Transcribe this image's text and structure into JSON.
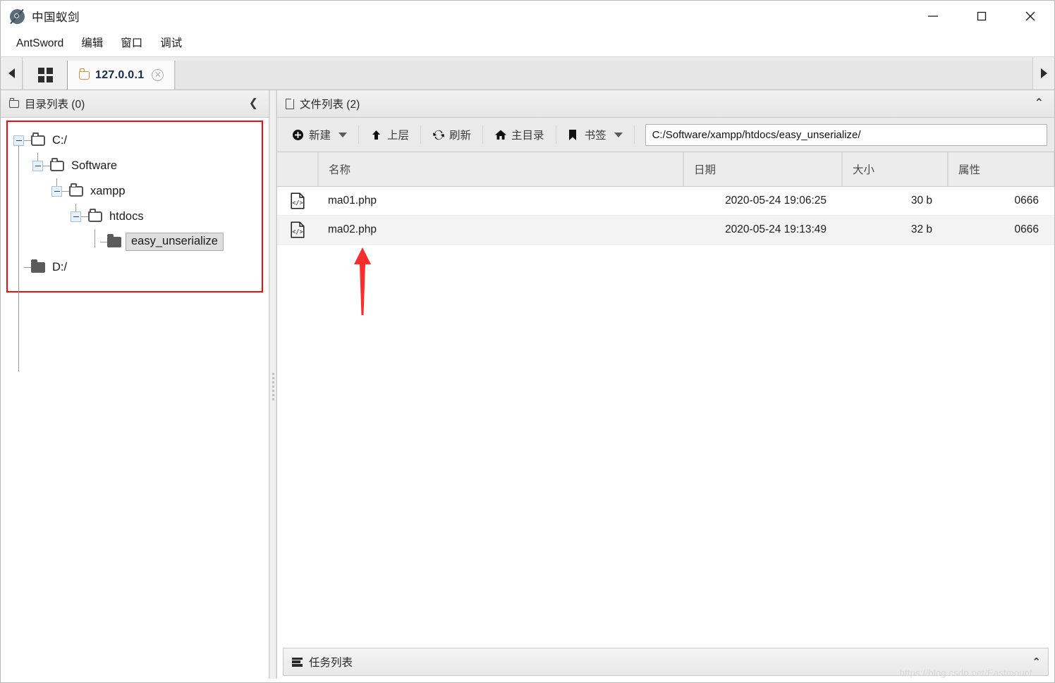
{
  "window": {
    "title": "中国蚁剑",
    "logo_icon": "antsword-logo-icon",
    "minimize_label": "—",
    "maximize_label": "□",
    "close_label": "✕"
  },
  "menubar": {
    "items": [
      {
        "label": "AntSword"
      },
      {
        "label": "编辑"
      },
      {
        "label": "窗口"
      },
      {
        "label": "调试"
      }
    ]
  },
  "tabbar": {
    "scroll_left_icon": "chevron-left-icon",
    "scroll_right_icon": "chevron-right-icon",
    "grid_button_icon": "grid-icon",
    "tabs": [
      {
        "label": "127.0.0.1",
        "icon": "folder-icon",
        "close_icon": "close-circle-icon",
        "active": true
      }
    ]
  },
  "directory_panel": {
    "icon": "folder-icon",
    "title": "目录列表 (0)",
    "collapse_icon": "chevron-left-icon",
    "tree": [
      {
        "label": "C:/",
        "depth": 0,
        "toggle": "minus",
        "folder": "open",
        "selected": false
      },
      {
        "label": "Software",
        "depth": 1,
        "toggle": "minus",
        "folder": "open",
        "selected": false
      },
      {
        "label": "xampp",
        "depth": 2,
        "toggle": "minus",
        "folder": "open",
        "selected": false
      },
      {
        "label": "htdocs",
        "depth": 3,
        "toggle": "minus",
        "folder": "open",
        "selected": false
      },
      {
        "label": "easy_unserialize",
        "depth": 4,
        "toggle": "none",
        "folder": "closed",
        "selected": true
      },
      {
        "label": "D:/",
        "depth": 0,
        "toggle": "none",
        "folder": "closed",
        "selected": false
      }
    ],
    "highlight_color": "#f10c0c"
  },
  "file_panel": {
    "icon": "file-icon",
    "title": "文件列表 (2)",
    "collapse_icon": "chevron-up-icon",
    "toolbar": [
      {
        "label": "新建",
        "icon": "plus-circle-icon",
        "dropdown": true
      },
      {
        "label": "上层",
        "icon": "arrow-up-icon",
        "dropdown": false
      },
      {
        "label": "刷新",
        "icon": "refresh-icon",
        "dropdown": false
      },
      {
        "label": "主目录",
        "icon": "home-icon",
        "dropdown": false
      },
      {
        "label": "书签",
        "icon": "bookmark-icon",
        "dropdown": true
      }
    ],
    "path": {
      "value": "C:/Software/xampp/htdocs/easy_unserialize/",
      "placeholder": "C:/"
    },
    "columns": [
      {
        "key": "icon",
        "label": ""
      },
      {
        "key": "name",
        "label": "名称"
      },
      {
        "key": "date",
        "label": "日期"
      },
      {
        "key": "size",
        "label": "大小"
      },
      {
        "key": "attr",
        "label": "属性"
      }
    ],
    "rows": [
      {
        "icon": "php-file-icon",
        "name": "ma01.php",
        "date": "2020-05-24 19:06:25",
        "size": "30 b",
        "attr": "0666"
      },
      {
        "icon": "php-file-icon",
        "name": "ma02.php",
        "date": "2020-05-24 19:13:49",
        "size": "32 b",
        "attr": "0666"
      }
    ]
  },
  "annotation": {
    "arrow_color": "#fa2d2d",
    "arrow_icon": "arrow-up-annotation-icon"
  },
  "footer": {
    "icon": "task-list-icon",
    "title": "任务列表",
    "collapse_icon": "chevron-up-icon",
    "watermark": "https://blog.csdn.net/Eastmount"
  }
}
